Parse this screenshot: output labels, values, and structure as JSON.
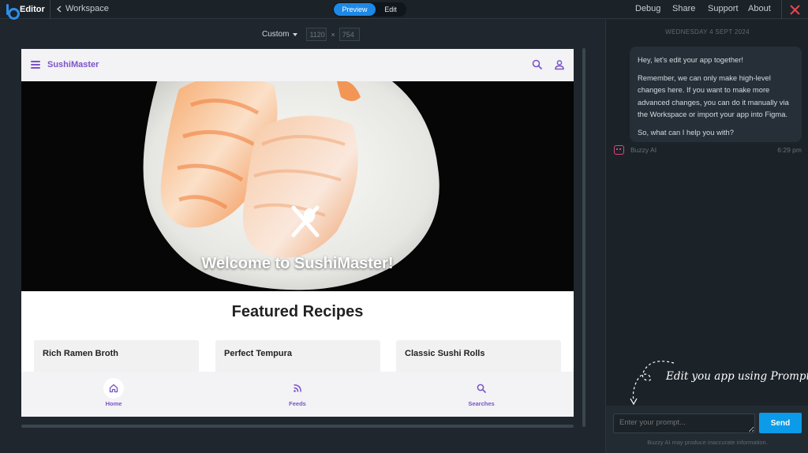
{
  "topbar": {
    "brand": "Editor",
    "back_label": "Workspace",
    "mode_preview": "Preview",
    "mode_edit": "Edit",
    "menu": [
      "Debug",
      "Share",
      "Support",
      "About"
    ]
  },
  "canvas": {
    "size_preset": "Custom",
    "width_value": "1120",
    "height_value": "754",
    "times": "×"
  },
  "app": {
    "title": "SushiMaster",
    "hero_title": "Welcome to SushiMaster!",
    "section_title": "Featured Recipes",
    "recipes": [
      "Rich Ramen Broth",
      "Perfect Tempura",
      "Classic Sushi Rolls"
    ],
    "nav": [
      "Home",
      "Feeds",
      "Searches"
    ],
    "accent": "#7b54c9"
  },
  "chat": {
    "date": "WEDNESDAY 4 SEPT 2024",
    "messages": [
      "Hey, let's edit your app together!",
      "Remember, we can only make high-level changes here. If you want to make more advanced changes, you can do it manually via the Workspace or import your app into Figma.",
      "So, what can I help you with?"
    ],
    "bot_name": "Buzzy AI",
    "time": "6:29 pm",
    "hint": "Edit you app using Prompt",
    "placeholder": "Enter your prompt...",
    "send_label": "Send",
    "disclaimer": "Buzzy AI may produce inaccurate information."
  },
  "colors": {
    "toggle_active": "#1e88e5",
    "send": "#0c9be8",
    "close": "#e8474f"
  }
}
